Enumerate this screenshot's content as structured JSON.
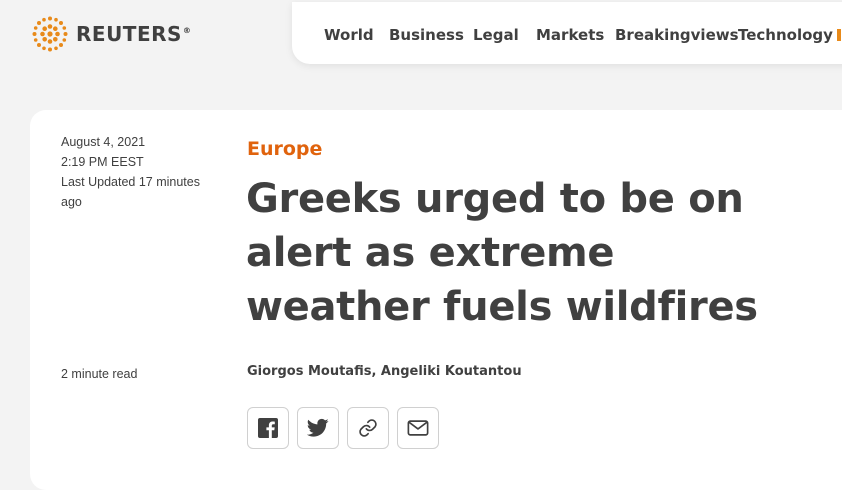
{
  "brand": {
    "name": "REUTERS",
    "registered": "®",
    "accent_color": "#e88a1a"
  },
  "nav": {
    "items": [
      {
        "label": "World"
      },
      {
        "label": "Business"
      },
      {
        "label": "Legal"
      },
      {
        "label": "Markets"
      },
      {
        "label": "Breakingviews"
      },
      {
        "label": "Technology"
      }
    ]
  },
  "article": {
    "date": "August 4, 2021",
    "time": "2:19 PM EEST",
    "last_updated": "Last Updated 17 minutes ago",
    "read_time": "2 minute read",
    "section": "Europe",
    "section_color": "#e0630d",
    "headline": "Greeks urged to be on alert as extreme weather fuels wildfires",
    "authors": "Giorgos Moutafis,  Angeliki Koutantou"
  },
  "share": {
    "buttons": [
      {
        "icon": "facebook-icon"
      },
      {
        "icon": "twitter-icon"
      },
      {
        "icon": "link-icon"
      },
      {
        "icon": "email-icon"
      }
    ]
  }
}
